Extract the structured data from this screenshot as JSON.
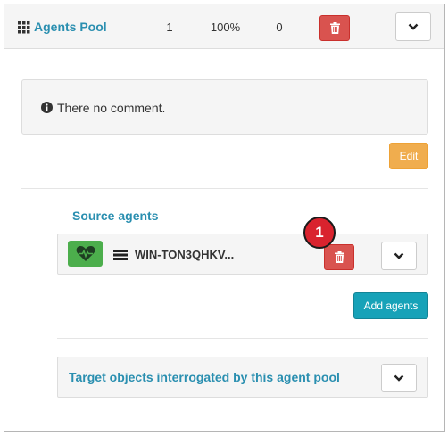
{
  "header": {
    "title": "Agents Pool",
    "count": "1",
    "percent": "100%",
    "zero": "0"
  },
  "comment": {
    "text": "There no comment."
  },
  "edit_button": {
    "label": "Edit"
  },
  "source_agents": {
    "label": "Source agents",
    "agents": [
      {
        "name": "WIN-TON3QHKV...",
        "status": "healthy"
      }
    ]
  },
  "callout": {
    "number": "1"
  },
  "add_agents_button": {
    "label": "Add agents"
  },
  "target_objects": {
    "label": "Target objects interrogated by this agent pool"
  },
  "icons": {
    "grid": "grid-icon",
    "trash": "trash-icon",
    "chevron": "chevron-down-icon",
    "info": "info-icon",
    "heartbeat": "heartbeat-icon",
    "server": "server-icon"
  },
  "colors": {
    "accent": "#2a8fb0",
    "danger": "#d9534f",
    "warning": "#f0ad4e",
    "primary": "#17a2b8",
    "success": "#4cae4c",
    "callout": "#d9232e"
  }
}
